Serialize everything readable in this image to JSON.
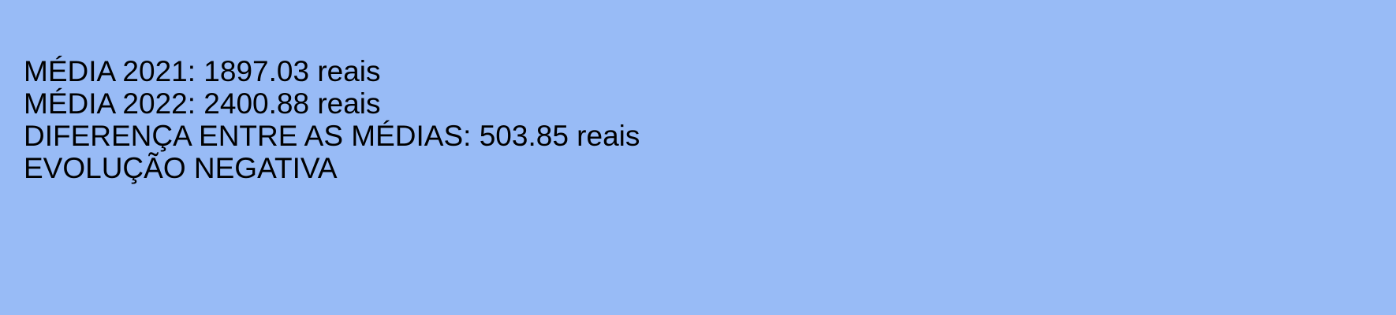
{
  "colors": {
    "background": "#98bbf6",
    "text": "#000000"
  },
  "output": {
    "lines": [
      "MÉDIA 2021: 1897.03 reais",
      "MÉDIA 2022: 2400.88 reais",
      "DIFERENÇA ENTRE AS MÉDIAS: 503.85 reais",
      "EVOLUÇÃO NEGATIVA"
    ]
  }
}
